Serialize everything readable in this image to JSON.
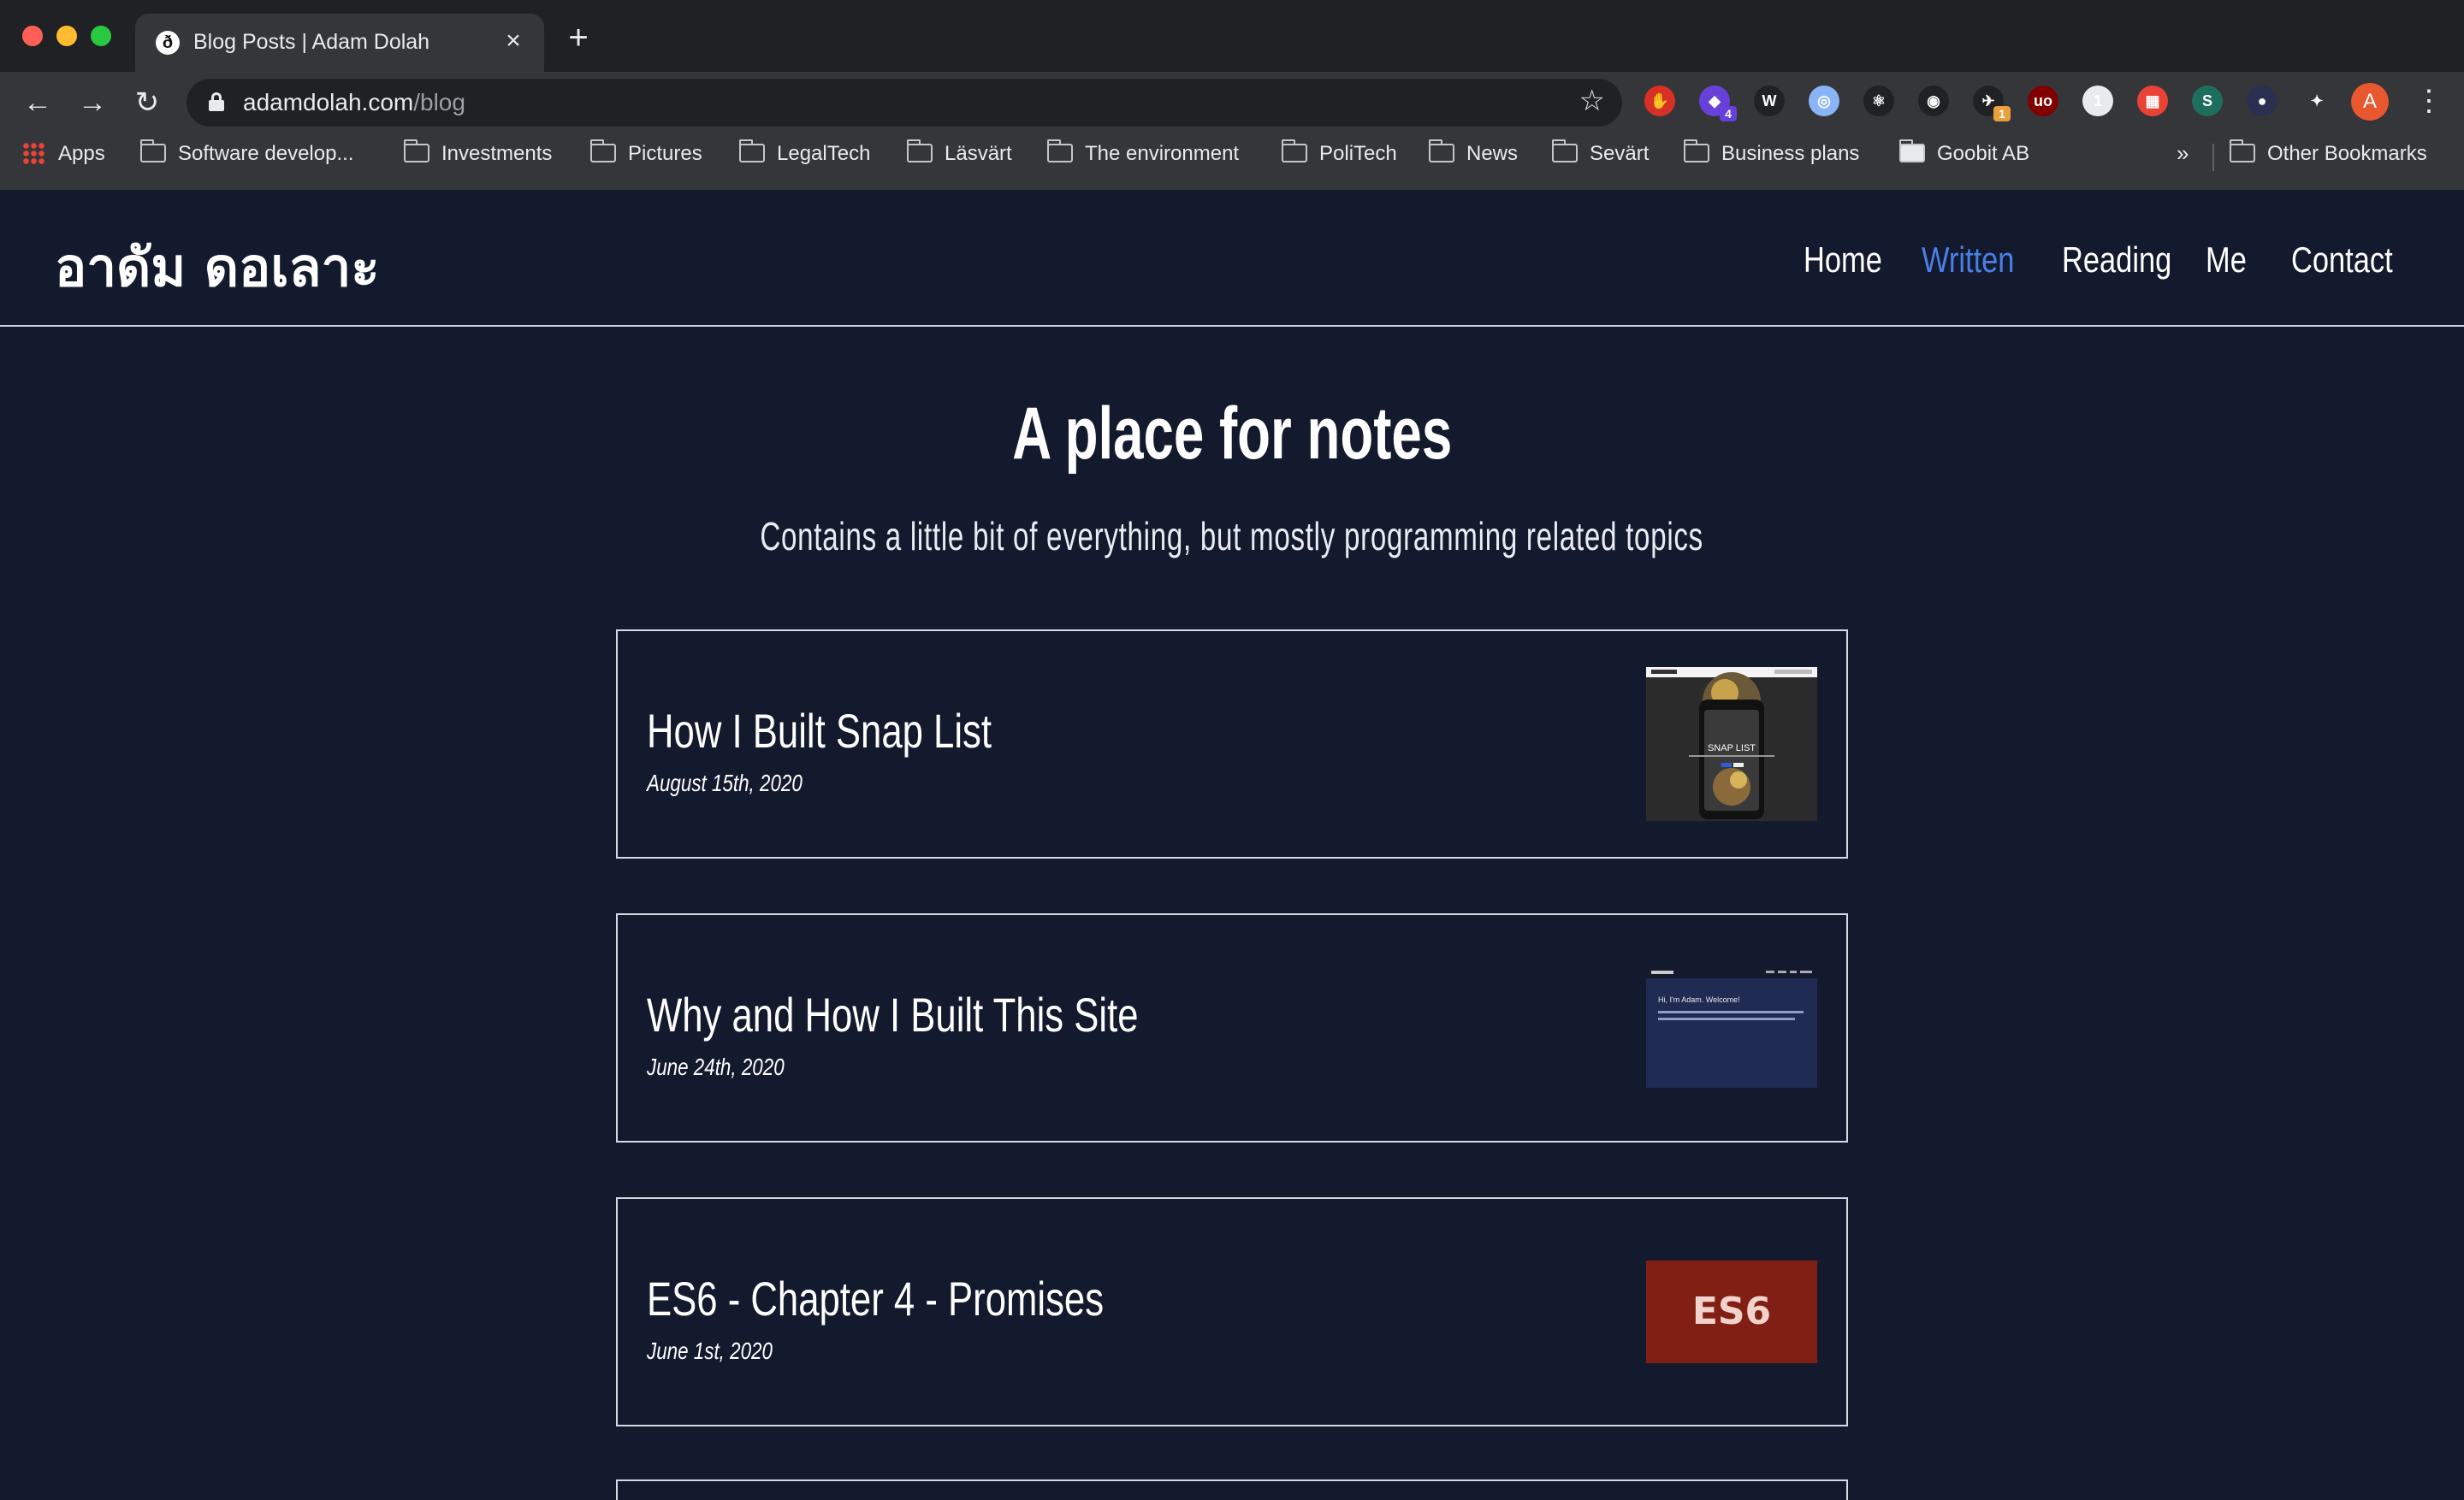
{
  "browser": {
    "tab": {
      "favicon": "ð",
      "title": "Blog Posts | Adam Dolah"
    },
    "url": {
      "host": "adamdolah.com",
      "path": "/blog"
    },
    "extensions": [
      {
        "icon": "stop-hand-icon",
        "color": "#d93025",
        "glyph": "✋"
      },
      {
        "icon": "extension-puzzle-4-icon",
        "color": "#6741d9",
        "glyph": "◆",
        "badge": "4"
      },
      {
        "icon": "wikiwand-icon",
        "color": "#202124",
        "glyph": "W"
      },
      {
        "icon": "circle-ring-icon",
        "color": "#8ab4f8",
        "glyph": "◎"
      },
      {
        "icon": "react-devtools-icon",
        "color": "#202124",
        "glyph": "⚛"
      },
      {
        "icon": "target-icon",
        "color": "#202124",
        "glyph": "◉"
      },
      {
        "icon": "rocket-1-icon",
        "color": "#202124",
        "glyph": "✈",
        "badge": "1"
      },
      {
        "icon": "ublock-icon",
        "color": "#800000",
        "glyph": "uo"
      },
      {
        "icon": "one-password-icon",
        "color": "#e8eaed",
        "glyph": "1"
      },
      {
        "icon": "grid-sheet-icon",
        "color": "#ea4335",
        "glyph": "▦"
      },
      {
        "icon": "stylus-s-icon",
        "color": "#1e6e5e",
        "glyph": "S"
      },
      {
        "icon": "dark-circle-icon",
        "color": "#2a3050",
        "glyph": "●"
      },
      {
        "icon": "puzzle-icon",
        "color": "#35363a",
        "glyph": "✦"
      }
    ],
    "profile_initial": "A",
    "bookmarks": [
      {
        "label": "Apps",
        "kind": "apps"
      },
      {
        "label": "Software develop...",
        "kind": "folder"
      },
      {
        "label": "Investments",
        "kind": "folder"
      },
      {
        "label": "Pictures",
        "kind": "folder"
      },
      {
        "label": "LegalTech",
        "kind": "folder"
      },
      {
        "label": "Läsvärt",
        "kind": "folder"
      },
      {
        "label": "The environment",
        "kind": "folder"
      },
      {
        "label": "PoliTech",
        "kind": "folder"
      },
      {
        "label": "News",
        "kind": "folder"
      },
      {
        "label": "Sevärt",
        "kind": "folder"
      },
      {
        "label": "Business plans",
        "kind": "folder"
      },
      {
        "label": "Goobit AB",
        "kind": "page"
      }
    ],
    "bookmarks_more": "»",
    "other_bookmarks": "Other Bookmarks"
  },
  "site": {
    "logo": "อาดัม ดอเลาะ",
    "nav": [
      {
        "label": "Home",
        "active": false
      },
      {
        "label": "Written",
        "active": true
      },
      {
        "label": "Reading",
        "active": false
      },
      {
        "label": "Me",
        "active": false
      },
      {
        "label": "Contact",
        "active": false
      }
    ],
    "accent": "#4a7fe8",
    "hero": {
      "title": "A place for notes",
      "subtitle": "Contains a little bit of everything, but mostly programming related topics"
    },
    "posts": [
      {
        "title": "How I Built Snap List",
        "date": "August 15th, 2020",
        "thumb": "snap-list-screenshot",
        "thumb_text": "SNAP LIST"
      },
      {
        "title": "Why and How I Built This Site",
        "date": "June 24th, 2020",
        "thumb": "site-screenshot",
        "thumb_text": "Hi, I'm Adam. Welcome!"
      },
      {
        "title": "ES6 - Chapter 4 - Promises",
        "date": "June 1st, 2020",
        "thumb": "es6-badge",
        "thumb_text": "ES6"
      }
    ]
  }
}
